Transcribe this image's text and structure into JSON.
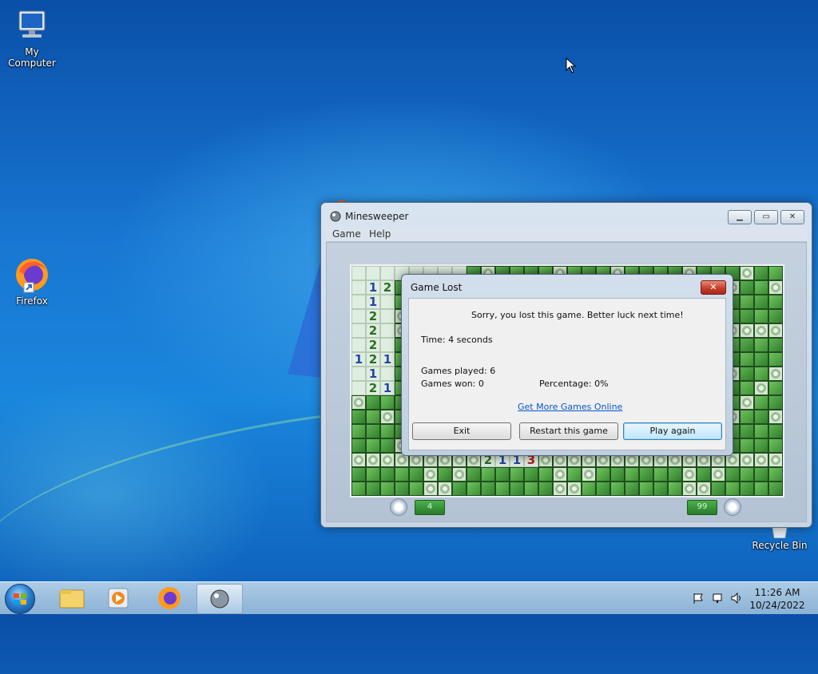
{
  "desktop": {
    "icons": [
      {
        "label": "My Computer"
      },
      {
        "label": "Firefox"
      },
      {
        "label": "Recycle Bin"
      }
    ]
  },
  "window": {
    "title": "Minesweeper",
    "menu": [
      "Game",
      "Help"
    ],
    "timer_value": "4",
    "mines_value": "99",
    "board": {
      "rows": 16,
      "cols": 30,
      "visible_numbers": [
        {
          "r": 1,
          "c": 1,
          "n": "1"
        },
        {
          "r": 1,
          "c": 2,
          "n": "2"
        },
        {
          "r": 2,
          "c": 1,
          "n": "1"
        },
        {
          "r": 3,
          "c": 1,
          "n": "2"
        },
        {
          "r": 4,
          "c": 1,
          "n": "2"
        },
        {
          "r": 5,
          "c": 1,
          "n": "2"
        },
        {
          "r": 6,
          "c": 0,
          "n": "1"
        },
        {
          "r": 6,
          "c": 1,
          "n": "2"
        },
        {
          "r": 6,
          "c": 2,
          "n": "1"
        },
        {
          "r": 7,
          "c": 1,
          "n": "1"
        },
        {
          "r": 8,
          "c": 1,
          "n": "2"
        },
        {
          "r": 8,
          "c": 2,
          "n": "1"
        },
        {
          "r": 13,
          "c": 9,
          "n": "2"
        },
        {
          "r": 13,
          "c": 10,
          "n": "1"
        },
        {
          "r": 13,
          "c": 11,
          "n": "1"
        },
        {
          "r": 13,
          "c": 12,
          "n": "3"
        }
      ]
    }
  },
  "dialog": {
    "title": "Game Lost",
    "close_label": "✕",
    "message": "Sorry, you lost this game. Better luck next time!",
    "time": "Time: 4 seconds",
    "games_played": "Games played: 6",
    "games_won": "Games won: 0",
    "percentage": "Percentage: 0%",
    "link": "Get More Games Online",
    "buttons": {
      "exit": "Exit",
      "restart": "Restart this game",
      "play_again": "Play again"
    }
  },
  "taskbar": {
    "clock_time": "11:26 AM",
    "clock_date": "10/24/2022",
    "pinned": [
      "start-orb",
      "file-explorer-icon",
      "media-player-icon",
      "firefox-icon",
      "minesweeper-icon"
    ]
  },
  "colors": {
    "dialog_link": "#0b56c7",
    "close_button": "#c5402c",
    "tile_green": "#3f8f35"
  }
}
